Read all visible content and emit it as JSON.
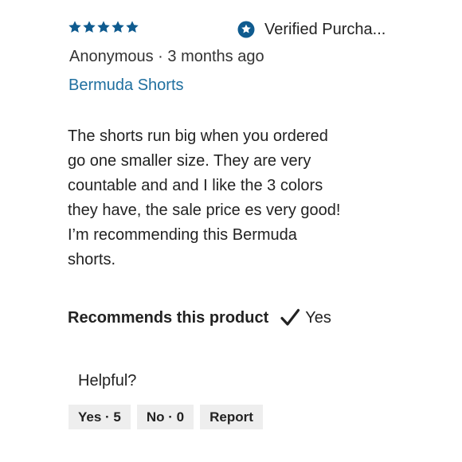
{
  "review": {
    "rating": 5,
    "rating_max": 5,
    "star_color": "#0f5b8f",
    "verified_label": "Verified Purcha...",
    "verified_icon": "star-badge-icon",
    "author_line": "Anonymous · 3 months ago",
    "product_name": "Bermuda Shorts",
    "product_link_color": "#1f6f9f",
    "body_lines": [
      "The shorts run big when you ordered",
      "go one smaller size. They are very",
      "countable and and I like the 3 colors",
      "they have, the sale price es very good!",
      "I’m recommending this Bermuda",
      "shorts."
    ],
    "recommend_label": "Recommends this product",
    "recommend_icon": "checkmark-icon",
    "recommend_value": "Yes"
  },
  "helpful": {
    "label": "Helpful?",
    "yes_label": "Yes · 5",
    "no_label": "No · 0",
    "report_label": "Report",
    "button_bg": "#eeeeee"
  }
}
